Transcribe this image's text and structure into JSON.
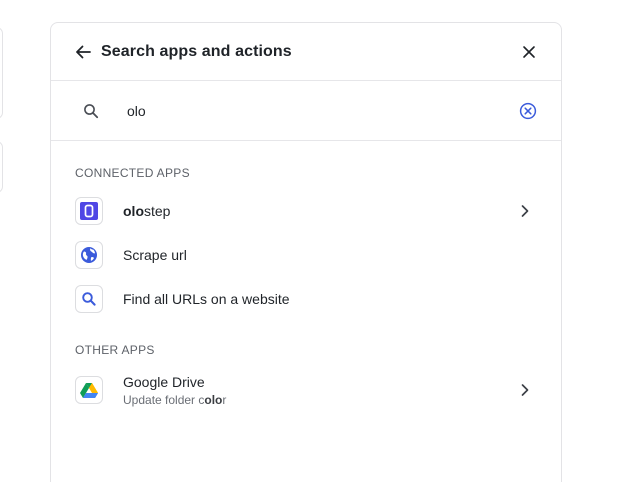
{
  "header": {
    "title": "Search apps and actions"
  },
  "search": {
    "value": "olo",
    "placeholder": ""
  },
  "connected": {
    "heading": "CONNECTED APPS",
    "items": [
      {
        "label_match": "olo",
        "label_rest": "step",
        "icon": "olostep-logo-icon"
      },
      {
        "label": "Scrape url",
        "icon": "globe-icon"
      },
      {
        "label": "Find all URLs on a website",
        "icon": "search-icon"
      }
    ]
  },
  "other": {
    "heading": "OTHER APPS",
    "items": [
      {
        "label": "Google Drive",
        "sub_prefix": "Update folder c",
        "sub_match": "olo",
        "sub_suffix": "r",
        "icon": "google-drive-icon"
      }
    ]
  },
  "colors": {
    "accent": "#3b5bdb",
    "olostep_brand": "#4f46e5",
    "text": "#1f2328",
    "muted": "#5d6168",
    "border": "#e3e3e6"
  }
}
